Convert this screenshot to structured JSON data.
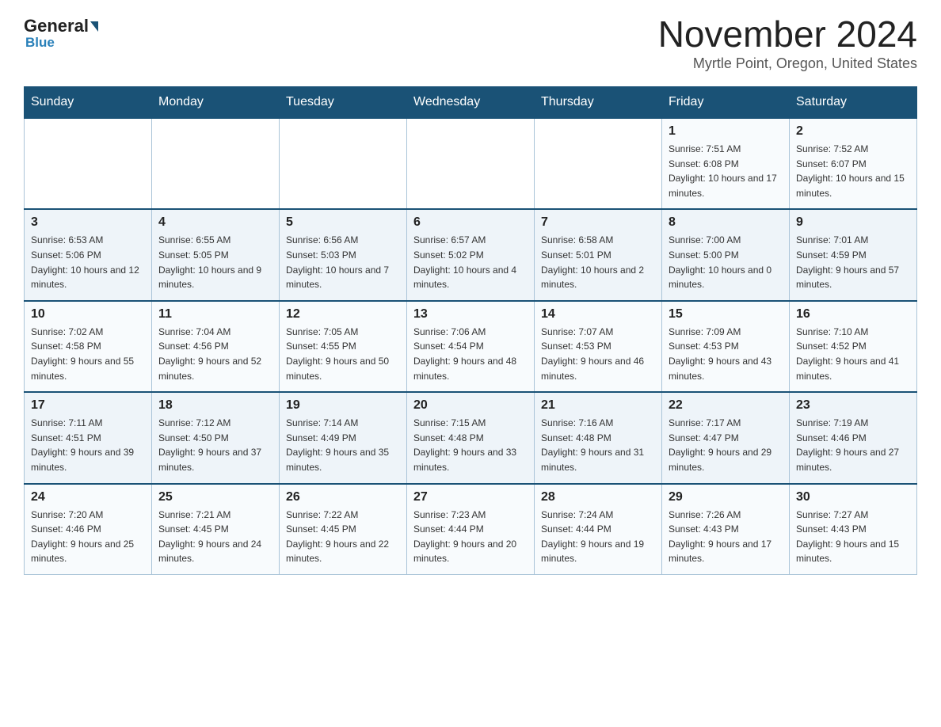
{
  "header": {
    "logo_general": "General",
    "logo_blue": "Blue",
    "month_title": "November 2024",
    "location": "Myrtle Point, Oregon, United States"
  },
  "days_of_week": [
    "Sunday",
    "Monday",
    "Tuesday",
    "Wednesday",
    "Thursday",
    "Friday",
    "Saturday"
  ],
  "weeks": [
    [
      {
        "day": "",
        "sunrise": "",
        "sunset": "",
        "daylight": ""
      },
      {
        "day": "",
        "sunrise": "",
        "sunset": "",
        "daylight": ""
      },
      {
        "day": "",
        "sunrise": "",
        "sunset": "",
        "daylight": ""
      },
      {
        "day": "",
        "sunrise": "",
        "sunset": "",
        "daylight": ""
      },
      {
        "day": "",
        "sunrise": "",
        "sunset": "",
        "daylight": ""
      },
      {
        "day": "1",
        "sunrise": "Sunrise: 7:51 AM",
        "sunset": "Sunset: 6:08 PM",
        "daylight": "Daylight: 10 hours and 17 minutes."
      },
      {
        "day": "2",
        "sunrise": "Sunrise: 7:52 AM",
        "sunset": "Sunset: 6:07 PM",
        "daylight": "Daylight: 10 hours and 15 minutes."
      }
    ],
    [
      {
        "day": "3",
        "sunrise": "Sunrise: 6:53 AM",
        "sunset": "Sunset: 5:06 PM",
        "daylight": "Daylight: 10 hours and 12 minutes."
      },
      {
        "day": "4",
        "sunrise": "Sunrise: 6:55 AM",
        "sunset": "Sunset: 5:05 PM",
        "daylight": "Daylight: 10 hours and 9 minutes."
      },
      {
        "day": "5",
        "sunrise": "Sunrise: 6:56 AM",
        "sunset": "Sunset: 5:03 PM",
        "daylight": "Daylight: 10 hours and 7 minutes."
      },
      {
        "day": "6",
        "sunrise": "Sunrise: 6:57 AM",
        "sunset": "Sunset: 5:02 PM",
        "daylight": "Daylight: 10 hours and 4 minutes."
      },
      {
        "day": "7",
        "sunrise": "Sunrise: 6:58 AM",
        "sunset": "Sunset: 5:01 PM",
        "daylight": "Daylight: 10 hours and 2 minutes."
      },
      {
        "day": "8",
        "sunrise": "Sunrise: 7:00 AM",
        "sunset": "Sunset: 5:00 PM",
        "daylight": "Daylight: 10 hours and 0 minutes."
      },
      {
        "day": "9",
        "sunrise": "Sunrise: 7:01 AM",
        "sunset": "Sunset: 4:59 PM",
        "daylight": "Daylight: 9 hours and 57 minutes."
      }
    ],
    [
      {
        "day": "10",
        "sunrise": "Sunrise: 7:02 AM",
        "sunset": "Sunset: 4:58 PM",
        "daylight": "Daylight: 9 hours and 55 minutes."
      },
      {
        "day": "11",
        "sunrise": "Sunrise: 7:04 AM",
        "sunset": "Sunset: 4:56 PM",
        "daylight": "Daylight: 9 hours and 52 minutes."
      },
      {
        "day": "12",
        "sunrise": "Sunrise: 7:05 AM",
        "sunset": "Sunset: 4:55 PM",
        "daylight": "Daylight: 9 hours and 50 minutes."
      },
      {
        "day": "13",
        "sunrise": "Sunrise: 7:06 AM",
        "sunset": "Sunset: 4:54 PM",
        "daylight": "Daylight: 9 hours and 48 minutes."
      },
      {
        "day": "14",
        "sunrise": "Sunrise: 7:07 AM",
        "sunset": "Sunset: 4:53 PM",
        "daylight": "Daylight: 9 hours and 46 minutes."
      },
      {
        "day": "15",
        "sunrise": "Sunrise: 7:09 AM",
        "sunset": "Sunset: 4:53 PM",
        "daylight": "Daylight: 9 hours and 43 minutes."
      },
      {
        "day": "16",
        "sunrise": "Sunrise: 7:10 AM",
        "sunset": "Sunset: 4:52 PM",
        "daylight": "Daylight: 9 hours and 41 minutes."
      }
    ],
    [
      {
        "day": "17",
        "sunrise": "Sunrise: 7:11 AM",
        "sunset": "Sunset: 4:51 PM",
        "daylight": "Daylight: 9 hours and 39 minutes."
      },
      {
        "day": "18",
        "sunrise": "Sunrise: 7:12 AM",
        "sunset": "Sunset: 4:50 PM",
        "daylight": "Daylight: 9 hours and 37 minutes."
      },
      {
        "day": "19",
        "sunrise": "Sunrise: 7:14 AM",
        "sunset": "Sunset: 4:49 PM",
        "daylight": "Daylight: 9 hours and 35 minutes."
      },
      {
        "day": "20",
        "sunrise": "Sunrise: 7:15 AM",
        "sunset": "Sunset: 4:48 PM",
        "daylight": "Daylight: 9 hours and 33 minutes."
      },
      {
        "day": "21",
        "sunrise": "Sunrise: 7:16 AM",
        "sunset": "Sunset: 4:48 PM",
        "daylight": "Daylight: 9 hours and 31 minutes."
      },
      {
        "day": "22",
        "sunrise": "Sunrise: 7:17 AM",
        "sunset": "Sunset: 4:47 PM",
        "daylight": "Daylight: 9 hours and 29 minutes."
      },
      {
        "day": "23",
        "sunrise": "Sunrise: 7:19 AM",
        "sunset": "Sunset: 4:46 PM",
        "daylight": "Daylight: 9 hours and 27 minutes."
      }
    ],
    [
      {
        "day": "24",
        "sunrise": "Sunrise: 7:20 AM",
        "sunset": "Sunset: 4:46 PM",
        "daylight": "Daylight: 9 hours and 25 minutes."
      },
      {
        "day": "25",
        "sunrise": "Sunrise: 7:21 AM",
        "sunset": "Sunset: 4:45 PM",
        "daylight": "Daylight: 9 hours and 24 minutes."
      },
      {
        "day": "26",
        "sunrise": "Sunrise: 7:22 AM",
        "sunset": "Sunset: 4:45 PM",
        "daylight": "Daylight: 9 hours and 22 minutes."
      },
      {
        "day": "27",
        "sunrise": "Sunrise: 7:23 AM",
        "sunset": "Sunset: 4:44 PM",
        "daylight": "Daylight: 9 hours and 20 minutes."
      },
      {
        "day": "28",
        "sunrise": "Sunrise: 7:24 AM",
        "sunset": "Sunset: 4:44 PM",
        "daylight": "Daylight: 9 hours and 19 minutes."
      },
      {
        "day": "29",
        "sunrise": "Sunrise: 7:26 AM",
        "sunset": "Sunset: 4:43 PM",
        "daylight": "Daylight: 9 hours and 17 minutes."
      },
      {
        "day": "30",
        "sunrise": "Sunrise: 7:27 AM",
        "sunset": "Sunset: 4:43 PM",
        "daylight": "Daylight: 9 hours and 15 minutes."
      }
    ]
  ]
}
